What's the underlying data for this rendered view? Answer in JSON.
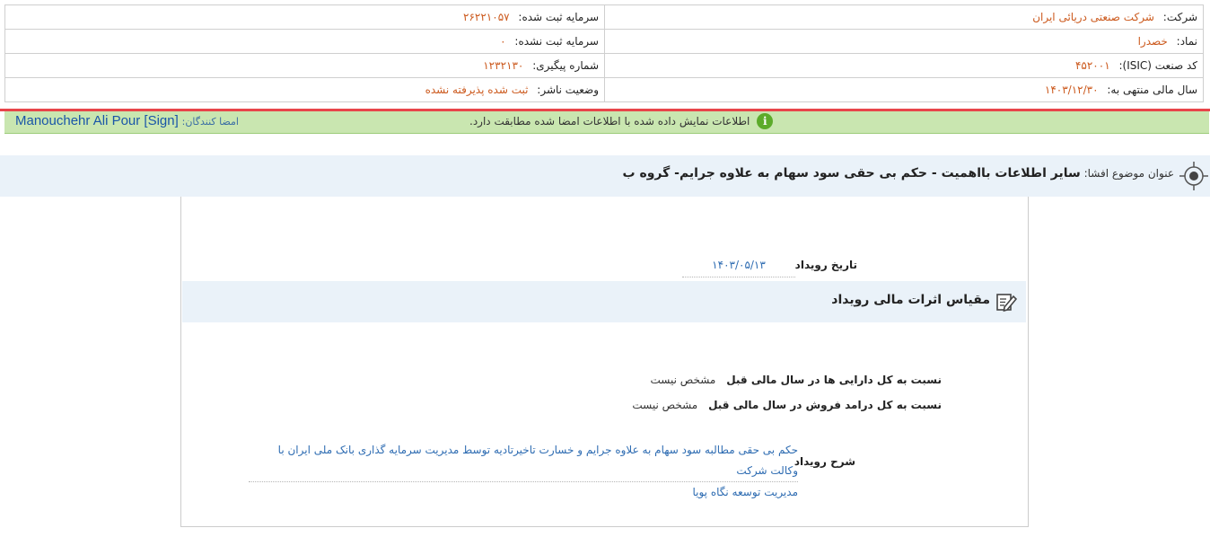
{
  "company_info": {
    "company_label": "شرکت:",
    "company_value": "شرکت صنعتی دریائی ایران",
    "registered_capital_label": "سرمایه ثبت شده:",
    "registered_capital_value": "۲۶۲۲۱۰۵۷",
    "symbol_label": "نماد:",
    "symbol_value": "خصدرا",
    "unregistered_capital_label": "سرمایه ثبت نشده:",
    "unregistered_capital_value": "۰",
    "isic_label": "کد صنعت (ISIC):",
    "isic_value": "۴۵۲۰۰۱",
    "tracking_label": "شماره پیگیری:",
    "tracking_value": "۱۲۳۲۱۳۰",
    "fiscal_year_label": "سال مالی منتهی به:",
    "fiscal_year_value": "۱۴۰۳/۱۲/۳۰",
    "publisher_status_label": "وضعیت ناشر:",
    "publisher_status_value": "ثبت شده پذیرفته نشده"
  },
  "signature_bar": {
    "signers_label": "امضا کنندگان:",
    "signer_name": "Manouchehr Ali Pour [Sign]",
    "match_message": "اطلاعات نمایش داده شده با اطلاعات امضا شده مطابقت دارد.",
    "info_icon": "info-icon"
  },
  "subject": {
    "label": "عنوان موضوع افشا:",
    "title": "سایر اطلاعات بااهمیت - حکم بی حقی سود سهام به علاوه جرایم- گروه ب",
    "icon": "target-icon"
  },
  "event": {
    "date_label": "تاریخ رویداد",
    "date_value": "۱۴۰۳/۰۵/۱۳"
  },
  "financial_effects": {
    "section_title": "مقیاس اثرات مالی رویداد",
    "section_icon": "edit-icon",
    "assets_ratio_label": "نسبت به کل دارایی ها در سال مالی قبل",
    "assets_ratio_value": "مشخص نیست",
    "revenue_ratio_label": "نسبت به کل درامد فروش در سال مالی قبل",
    "revenue_ratio_value": "مشخص نیست",
    "description_label": "شرح رویداد",
    "description_line1": "حکم بی حقی مطالبه سود سهام به علاوه جرایم و خسارت تاخیرتادیه توسط مدیریت سرمایه گذاری بانک ملی ایران با وکالت شرکت",
    "description_line2": "مدیریت توسعه نگاه پویا"
  },
  "colors": {
    "value_orange": "#cc5a1e",
    "link_blue": "#2e6cb2",
    "signature_green_bg": "#c9e6b0",
    "alert_red": "#e8454a",
    "header_blue_bg": "#eaf2f9"
  }
}
